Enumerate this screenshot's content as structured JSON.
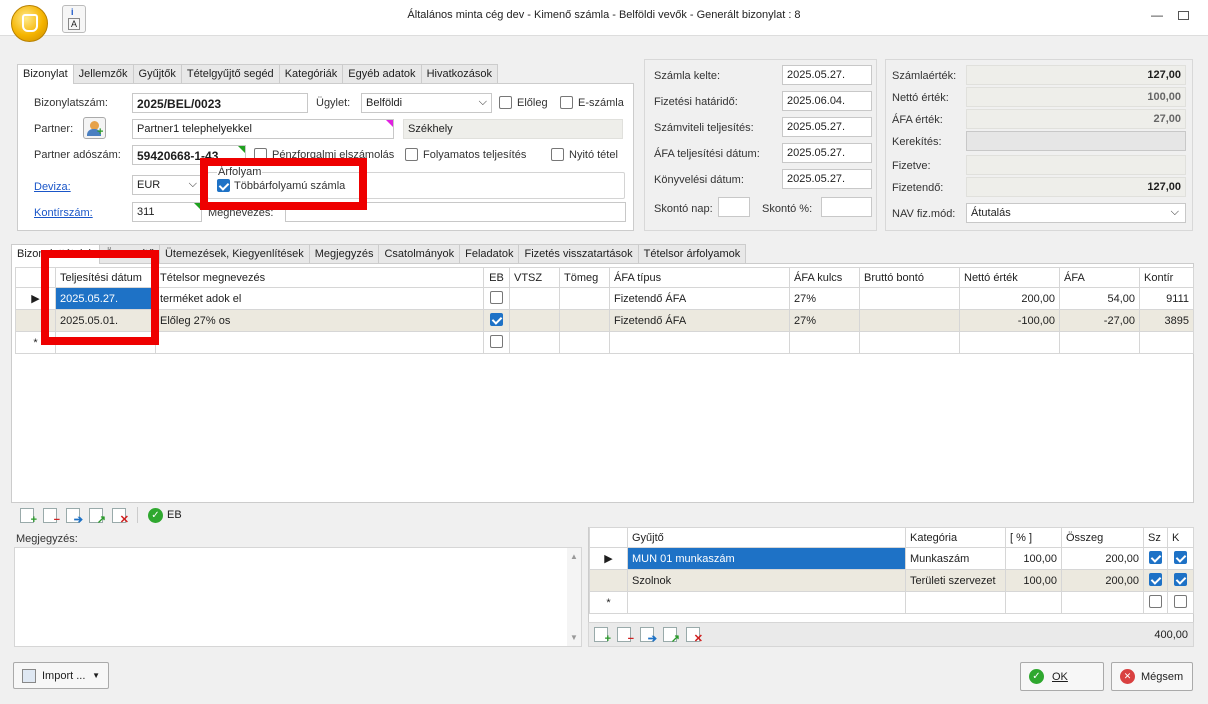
{
  "window": {
    "title": "Általános minta cég dev - Kimenő számla - Belföldi vevők - Generált bizonylat : 8"
  },
  "top_tabs": [
    "Bizonylat",
    "Jellemzők",
    "Gyűjtők",
    "Tételgyűjtő segéd",
    "Kategóriák",
    "Egyéb adatok",
    "Hivatkozások"
  ],
  "form": {
    "bizonylatszam_label": "Bizonylatszám:",
    "bizonylatszam": "2025/BEL/0023",
    "ugylet_label": "Ügylet:",
    "ugylet": "Belföldi",
    "eloleg_label": "Előleg",
    "eszamla_label": "E-számla",
    "partner_label": "Partner:",
    "partner": "Partner1 telephelyekkel",
    "szekhely": "Székhely",
    "partner_adoszam_label": "Partner adószám:",
    "partner_adoszam": "59420668-1-43",
    "penzforgalmi_label": "Pénzforgalmi elszámolás",
    "folyamatos_label": "Folyamatos teljesítés",
    "nyito_label": "Nyitó tétel",
    "deviza_label": "Deviza:",
    "deviza": "EUR",
    "arfolyam_label": "Árfolyam",
    "tobbarfolyamu_label": "Többárfolyamú számla",
    "kontirszam_label": "Kontírszám:",
    "kontirszam": "311",
    "megnevezes_label": "Megnevezés:"
  },
  "dates": {
    "szamla_kelte_label": "Számla kelte:",
    "szamla_kelte": "2025.05.27.",
    "fizetesi_hatarido_label": "Fizetési határidő:",
    "fizetesi_hatarido": "2025.06.04.",
    "szamviteli_label": "Számviteli teljesítés:",
    "szamviteli": "2025.05.27.",
    "afa_telj_label": "ÁFA teljesítési dátum:",
    "afa_telj": "2025.05.27.",
    "konyvelesi_label": "Könyvelési dátum:",
    "konyvelesi": "2025.05.27.",
    "skonto_nap_label": "Skontó nap:",
    "skonto_pct_label": "Skontó %:"
  },
  "totals": {
    "szamlaertek_label": "Számlaérték:",
    "szamlaertek": "127,00",
    "netto_label": "Nettó érték:",
    "netto": "100,00",
    "afa_label": "ÁFA érték:",
    "afa": "27,00",
    "kerekites_label": "Kerekítés:",
    "fizetve_label": "Fizetve:",
    "fizetendo_label": "Fizetendő:",
    "fizetendo": "127,00",
    "nav_label": "NAV fiz.mód:",
    "nav": "Átutalás"
  },
  "item_tabs": [
    "Bizonylattételek",
    "Összesítő",
    "Ütemezések, Kiegyenlítések",
    "Megjegyzés",
    "Csatolmányok",
    "Feladatok",
    "Fizetés visszatartások",
    "Tételsor árfolyamok"
  ],
  "items": {
    "columns": [
      "Teljesítési dátum",
      "Tételsor megnevezés",
      "EB",
      "VTSZ",
      "Tömeg",
      "ÁFA típus",
      "ÁFA kulcs",
      "Bruttó bontó",
      "Nettó érték",
      "ÁFA",
      "Kontír"
    ],
    "rows": [
      {
        "date": "2025.05.27.",
        "name": "terméket adok el",
        "eb": false,
        "afa_tipus": "Fizetendő ÁFA",
        "afa_kulcs": "27%",
        "netto": "200,00",
        "afa": "54,00",
        "kontir": "9111"
      },
      {
        "date": "2025.05.01.",
        "name": "Előleg 27% os",
        "eb": true,
        "afa_tipus": "Fizetendő ÁFA",
        "afa_kulcs": "27%",
        "netto": "-100,00",
        "afa": "-27,00",
        "kontir": "3895"
      }
    ]
  },
  "toolbar": {
    "eb_label": "EB"
  },
  "megjegyzes_label": "Megjegyzés:",
  "gyujto": {
    "columns": [
      "Gyűjtő",
      "Kategória",
      "[ % ]",
      "Összeg",
      "Sz",
      "K"
    ],
    "rows": [
      {
        "gyujto": "MUN 01 munkaszám",
        "kategoria": "Munkaszám",
        "pct": "100,00",
        "osszeg": "200,00",
        "sz": true,
        "k": true
      },
      {
        "gyujto": "Szolnok",
        "kategoria": "Területi szervezet",
        "pct": "100,00",
        "osszeg": "200,00",
        "sz": true,
        "k": true
      }
    ],
    "total": "400,00"
  },
  "buttons": {
    "import": "Import ...",
    "ok": "OK",
    "megsem": "Mégsem"
  },
  "colors": {
    "accent": "#1e72c6",
    "highlight": "#ee0000",
    "alt_row": "#ece9df"
  }
}
